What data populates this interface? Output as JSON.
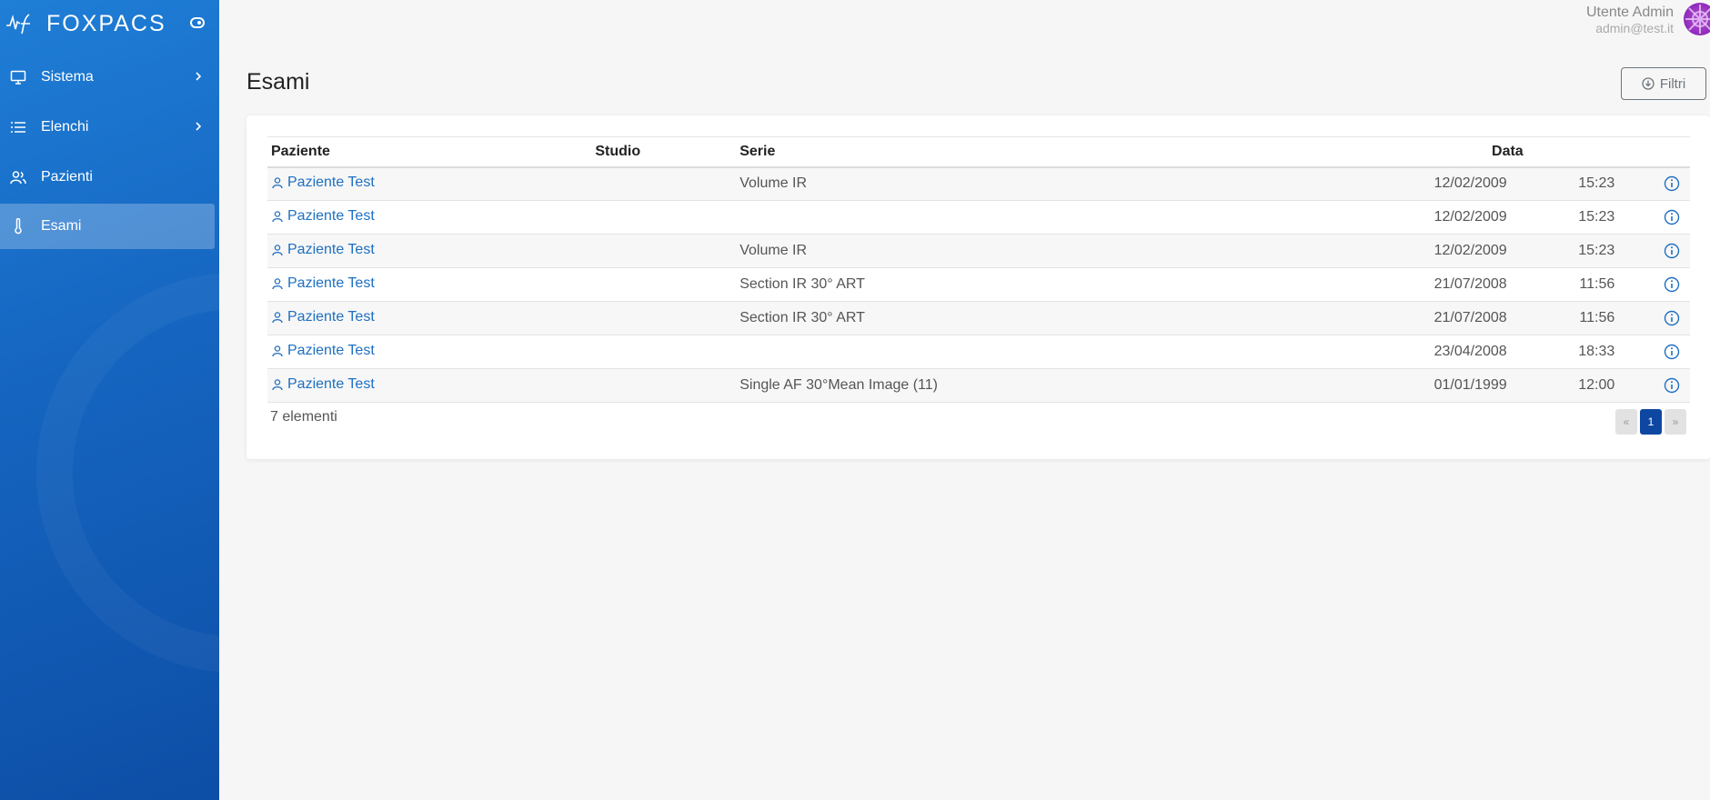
{
  "app": {
    "name": "FOXPACS"
  },
  "sidebar": {
    "items": [
      {
        "label": "Sistema",
        "icon": "monitor-icon",
        "has_submenu": true
      },
      {
        "label": "Elenchi",
        "icon": "list-icon",
        "has_submenu": true
      },
      {
        "label": "Pazienti",
        "icon": "users-icon",
        "has_submenu": false
      },
      {
        "label": "Esami",
        "icon": "thermometer-icon",
        "has_submenu": false,
        "active": true
      }
    ]
  },
  "user": {
    "name": "Utente Admin",
    "email": "admin@test.it"
  },
  "page": {
    "title": "Esami",
    "filter_label": "Filtri"
  },
  "table": {
    "columns": [
      "Paziente",
      "Studio",
      "Serie",
      "Data"
    ],
    "rows": [
      {
        "patient": "Paziente Test",
        "study": "",
        "series": "Volume IR",
        "date": "12/02/2009",
        "time": "15:23"
      },
      {
        "patient": "Paziente Test",
        "study": "",
        "series": "",
        "date": "12/02/2009",
        "time": "15:23"
      },
      {
        "patient": "Paziente Test",
        "study": "",
        "series": "Volume IR",
        "date": "12/02/2009",
        "time": "15:23"
      },
      {
        "patient": "Paziente Test",
        "study": "",
        "series": "Section IR 30° ART",
        "date": "21/07/2008",
        "time": "11:56"
      },
      {
        "patient": "Paziente Test",
        "study": "",
        "series": "Section IR 30° ART",
        "date": "21/07/2008",
        "time": "11:56"
      },
      {
        "patient": "Paziente Test",
        "study": "",
        "series": "",
        "date": "23/04/2008",
        "time": "18:33"
      },
      {
        "patient": "Paziente Test",
        "study": "",
        "series": "Single AF 30°Mean Image (11)",
        "date": "01/01/1999",
        "time": "12:00"
      }
    ],
    "count_label": "7 elementi"
  },
  "pagination": {
    "prev": "«",
    "current": "1",
    "next": "»"
  },
  "colors": {
    "sidebar": "#1565c0",
    "link": "#1e6fc0",
    "pager_active": "#0d47a1"
  }
}
